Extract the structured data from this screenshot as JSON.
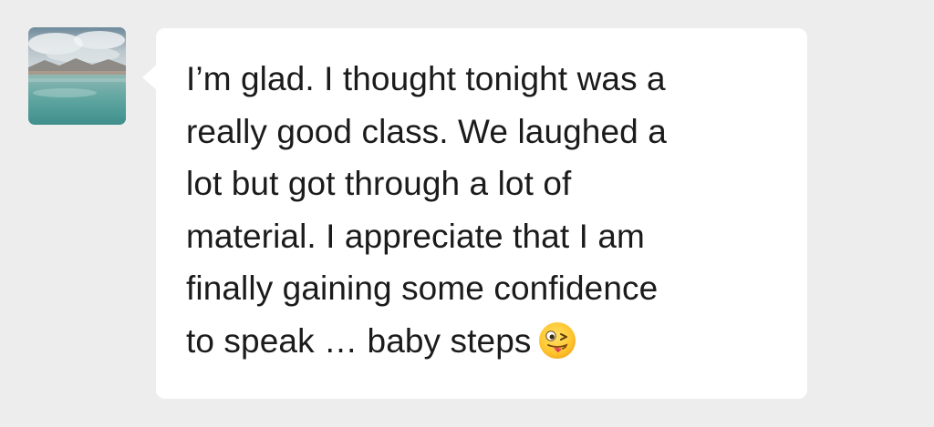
{
  "chat": {
    "contact_avatar": "landscape-lake-avatar",
    "message": {
      "text": "I’m glad. I thought tonight was a\nreally good class. We laughed a\nlot but got through a lot of\nmaterial. I appreciate that I am\nfinally gaining some confidence\nto speak … baby steps",
      "emoji": "winking-face-with-tongue-icon"
    }
  },
  "colors": {
    "background": "#ededed",
    "bubble": "#ffffff",
    "text": "#1b1b1b"
  }
}
